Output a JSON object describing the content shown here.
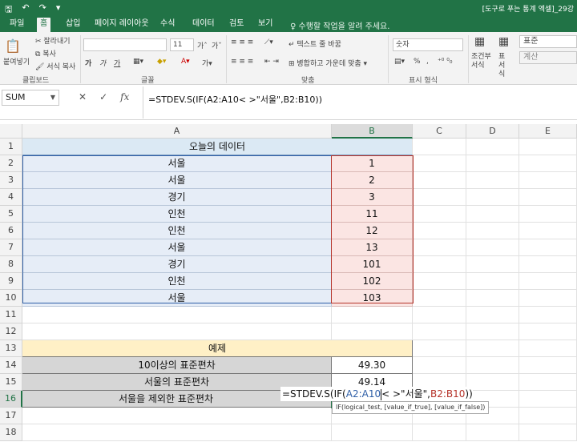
{
  "title_bar": {
    "document_title": "[도구로 푸는 통계 엑셀]_29강",
    "qat_icons": [
      "save-icon",
      "undo-icon",
      "redo-icon",
      "customize-icon"
    ]
  },
  "tabs": [
    "파일",
    "홈",
    "삽입",
    "페이지 레이아웃",
    "수식",
    "데이터",
    "검토",
    "보기"
  ],
  "active_tab": "홈",
  "tell_me": "♀ 수행할 작업을 알려 주세요.",
  "ribbon": {
    "clipboard": {
      "paste": "붙여넣기",
      "cut": "잘라내기",
      "copy": "복사",
      "format_painter": "서식 복사",
      "label": "클립보드"
    },
    "font": {
      "font_name": "",
      "font_size": "11",
      "bold": "가",
      "italic": "가",
      "underline": "가",
      "grow": "가",
      "shrink": "가",
      "label": "글꼴"
    },
    "alignment": {
      "wrap": "텍스트 줄 바꿈",
      "merge": "병합하고 가운데 맞춤",
      "label": "맞춤"
    },
    "number": {
      "format": "숫자",
      "percent": "%",
      "comma": ",",
      "label": "표시 형식"
    },
    "styles": {
      "conditional": "조건부 서식",
      "table": "표 서식",
      "style_normal": "표준",
      "style_bad": "계산"
    }
  },
  "formula_bar": {
    "name_box": "SUM",
    "cancel": "✕",
    "enter": "✓",
    "fx": "fx",
    "formula": "=STDEV.S(IF(A2:A10< >\"서울\",B2:B10))"
  },
  "columns": [
    "A",
    "B",
    "C",
    "D",
    "E"
  ],
  "rows": [
    "1",
    "2",
    "3",
    "4",
    "5",
    "6",
    "7",
    "8",
    "9",
    "10",
    "11",
    "12",
    "13",
    "14",
    "15",
    "16",
    "17",
    "18"
  ],
  "table": {
    "title": "오늘의 데이터",
    "regions": [
      "서울",
      "서울",
      "경기",
      "인천",
      "인천",
      "서울",
      "경기",
      "인천",
      "서울"
    ],
    "values": [
      "1",
      "2",
      "3",
      "11",
      "12",
      "13",
      "101",
      "102",
      "103"
    ]
  },
  "example": {
    "title": "예제",
    "rows": [
      {
        "label": "10이상의 표준편차",
        "value": "49.30"
      },
      {
        "label": "서울의 표준편차",
        "value": "49.14"
      },
      {
        "label": "서울을 제외한 표준편차",
        "value": ""
      }
    ]
  },
  "editing": {
    "prefix": "=STDEV.S(IF(",
    "ref1": "A2:A10",
    "op": "< >",
    "mid": "\"서울\",",
    "ref2": "B2:B10",
    "suffix": "))",
    "tooltip": "IF(logical_test, [value_if_true], [value_if_false])"
  },
  "colors": {
    "excel_green": "#217346",
    "range_blue": "#2f5fa7",
    "range_red": "#b5332a"
  }
}
